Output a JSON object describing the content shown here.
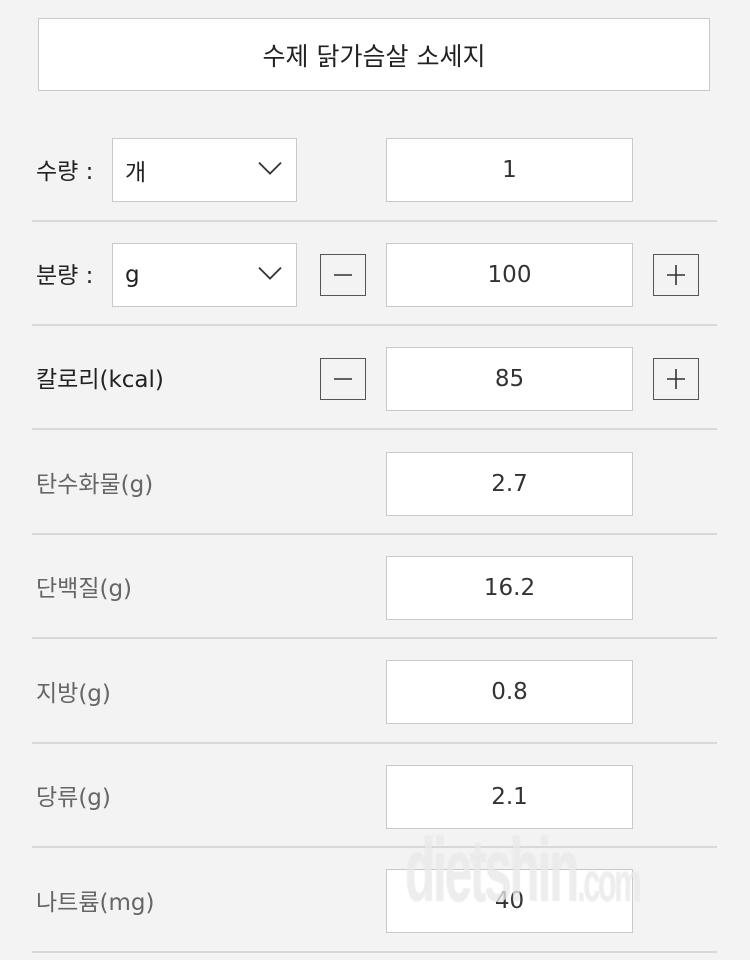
{
  "food_title": "수제 닭가슴살 소세지",
  "quantity": {
    "label": "수량 :",
    "unit_selected": "개",
    "value": "1"
  },
  "serving": {
    "label": "분량 :",
    "unit_selected": "g",
    "value": "100",
    "decrement_icon": "minus-icon",
    "increment_icon": "plus-icon"
  },
  "calories": {
    "label": "칼로리(kcal)",
    "value": "85",
    "decrement_icon": "minus-icon",
    "increment_icon": "plus-icon"
  },
  "nutrients": [
    {
      "label": "탄수화물(g)",
      "value": "2.7"
    },
    {
      "label": "단백질(g)",
      "value": "16.2"
    },
    {
      "label": "지방(g)",
      "value": "0.8"
    },
    {
      "label": "당류(g)",
      "value": "2.1"
    },
    {
      "label": "나트륨(mg)",
      "value": "40"
    }
  ],
  "watermark": {
    "main": "dietshin",
    "suffix": ".com"
  }
}
